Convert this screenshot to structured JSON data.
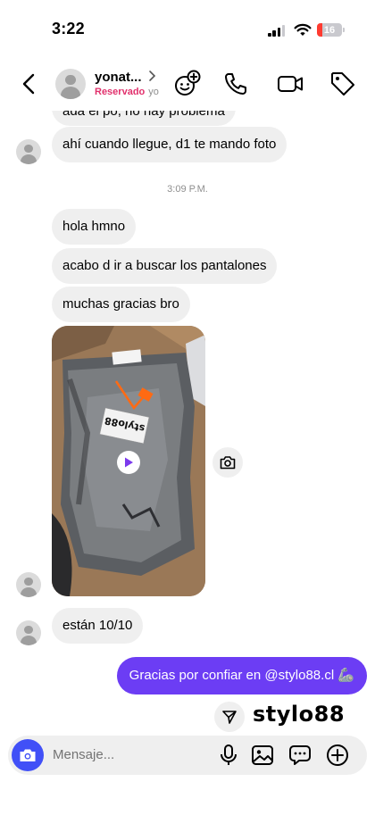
{
  "status_bar": {
    "time": "3:22",
    "battery": "16"
  },
  "header": {
    "name": "yonat...",
    "tag": "Reservado",
    "sub_rest": "yo",
    "icons": [
      "back-icon",
      "sticker-plus-icon",
      "phone-icon",
      "video-icon",
      "tag-icon"
    ]
  },
  "messages": {
    "partial": "ada el po, no hay problema",
    "m1": "ahí cuando llegue, d1 te mando foto",
    "timestamp": "3:09 P.M.",
    "m2": "hola hmno",
    "m3": "acabo d ir a buscar los pantalones",
    "m4": "muchas gracias bro",
    "photo_label": "stylo88",
    "m5": "están 10/10",
    "sent": "Gracias por confiar en @stylo88.cl 🦾"
  },
  "sticker": {
    "text": "stylo88"
  },
  "composer": {
    "placeholder": "Mensaje...",
    "icons": [
      "camera-icon",
      "microphone-icon",
      "gallery-icon",
      "sticker-icon",
      "add-icon"
    ]
  },
  "colors": {
    "accent": "#6c3df4",
    "camera": "#4150f7",
    "tag": "#e1306c",
    "bubble": "#efefef"
  }
}
